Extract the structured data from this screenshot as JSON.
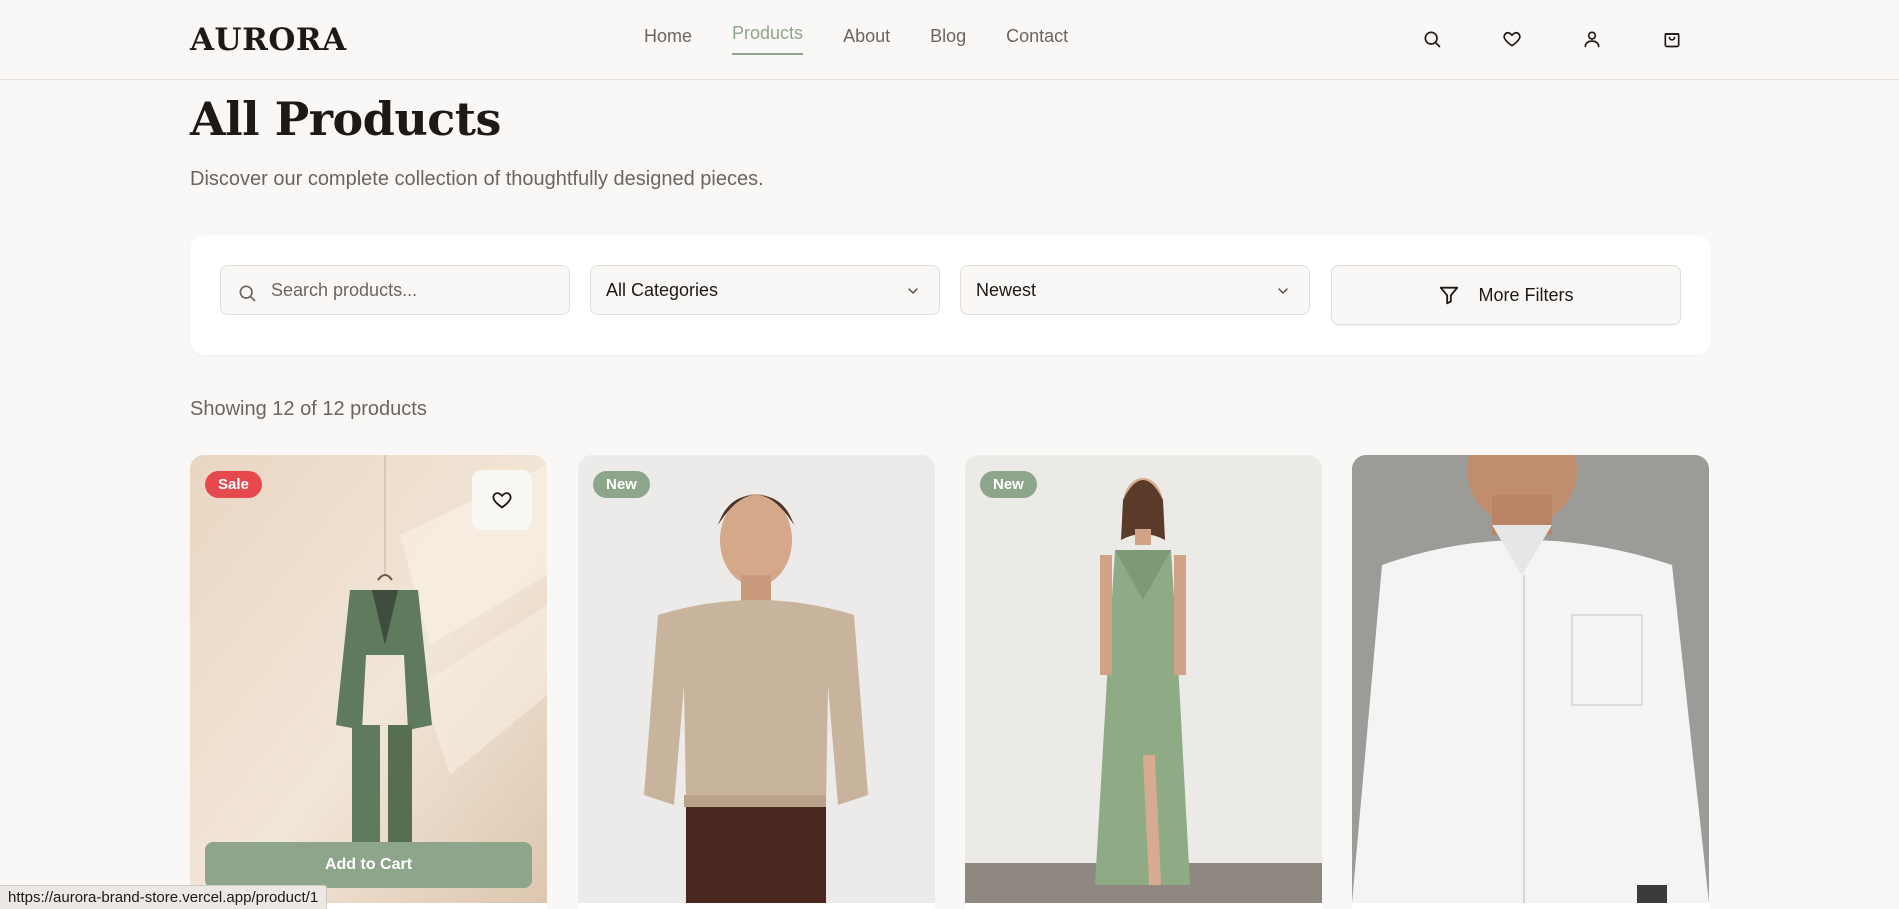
{
  "header": {
    "logo": "AURORA",
    "nav": [
      {
        "label": "Home",
        "active": false
      },
      {
        "label": "Products",
        "active": true
      },
      {
        "label": "About",
        "active": false
      },
      {
        "label": "Blog",
        "active": false
      },
      {
        "label": "Contact",
        "active": false
      }
    ],
    "icons": [
      "search-icon",
      "heart-icon",
      "user-icon",
      "shopping-bag-icon"
    ]
  },
  "page": {
    "title": "All Products",
    "subtitle": "Discover our complete collection of thoughtfully designed pieces."
  },
  "filters": {
    "search_placeholder": "Search products...",
    "category": "All Categories",
    "sort": "Newest",
    "more_label": "More Filters"
  },
  "results": {
    "count_text": "Showing 12 of 12 products"
  },
  "products": [
    {
      "badge": "Sale",
      "badge_type": "sale",
      "add_to_cart": "Add to Cart",
      "image": "green suit on hanger"
    },
    {
      "badge": "New",
      "badge_type": "new",
      "image": "man in beige sweater"
    },
    {
      "badge": "New",
      "badge_type": "new",
      "image": "woman in sage green dress"
    },
    {
      "badge": "",
      "badge_type": "",
      "image": "man in white shirt"
    }
  ],
  "status_bar": {
    "url": "https://aurora-brand-store.vercel.app/product/1"
  },
  "colors": {
    "accent": "#8da58a",
    "sale": "#e5484d",
    "background": "#faf8f6",
    "text": "#1c1917",
    "muted": "#6b6560"
  }
}
